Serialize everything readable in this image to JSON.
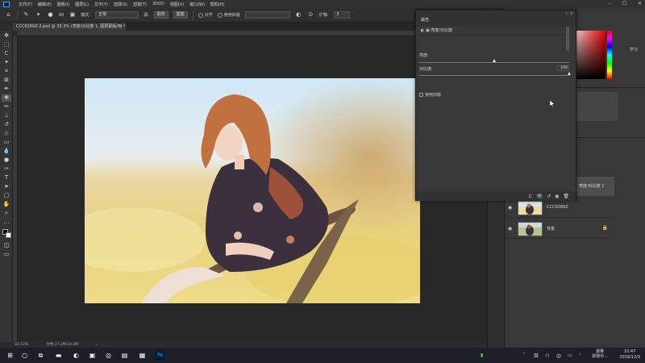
{
  "menu": [
    "文件(F)",
    "编辑(E)",
    "图像(I)",
    "图层(L)",
    "文字(Y)",
    "选择(S)",
    "滤镜(T)",
    "3D(D)",
    "视图(V)",
    "窗口(W)",
    "帮助(H)"
  ],
  "options": {
    "brush_size": "60",
    "mode_label": "模式:",
    "mode_value": "正常",
    "source_sampled": "取样",
    "source_pattern": "图案",
    "aligned_label": "对齐",
    "use_legacy_label": "使用旧版",
    "diffusion_label": "扩散:",
    "diffusion_value": "5"
  },
  "document": {
    "tab_title": "CCC0289Z-2.psd @ 33.3% (亮度/对比度 1, 图层蒙版/8) *",
    "zoom": "33.33%",
    "doc_size": "文档:17.2M/34.3M"
  },
  "properties": {
    "title": "属性",
    "adjustment_type": "亮度/对比度",
    "brightness_label": "亮度:",
    "brightness_value": "",
    "brightness_level": 0.5,
    "contrast_label": "对比度:",
    "contrast_value": "100",
    "contrast_level": 1.0,
    "legacy_label": "使用旧版"
  },
  "right_panel": {
    "learn_label": "学习"
  },
  "layers": [
    {
      "name": "亮度/对比度 1",
      "selected": true
    },
    {
      "name": "CCC0289Z",
      "selected": false
    },
    {
      "name": "背景",
      "selected": false,
      "locked": true
    }
  ],
  "taskbar": {
    "weather_line1": "晨雾",
    "weather_line2": "获取中...",
    "time": "10:47",
    "date": "2018/12/9"
  },
  "colors": {
    "foreground": "#000000",
    "background": "#ffffff",
    "panel_bg": "#383838",
    "canvas_bg": "#282828"
  }
}
